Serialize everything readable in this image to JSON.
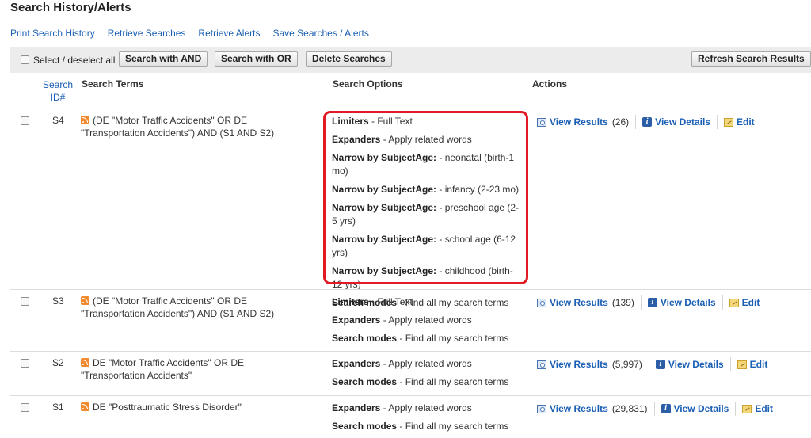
{
  "page": {
    "title": "Search History/Alerts",
    "links": [
      "Print Search History",
      "Retrieve Searches",
      "Retrieve Alerts",
      "Save Searches / Alerts"
    ]
  },
  "toolbar": {
    "select_label": "Select / deselect all",
    "and_label": "Search with AND",
    "or_label": "Search with OR",
    "delete_label": "Delete Searches",
    "refresh_label": "Refresh Search Results"
  },
  "headers": {
    "id": "Search ID#",
    "terms": "Search Terms",
    "options": "Search Options",
    "actions": "Actions"
  },
  "actions": {
    "view_results": "View Results",
    "view_details": "View Details",
    "edit": "Edit"
  },
  "rows": [
    {
      "id": "S4",
      "terms": "(DE \"Motor Traffic Accidents\" OR DE \"Transportation Accidents\") AND (S1 AND S2)",
      "count": "(26)",
      "options": [
        {
          "label": "Limiters",
          "value": " - Full Text"
        },
        {
          "label": "Expanders",
          "value": " - Apply related words"
        },
        {
          "label": "Narrow by SubjectAge:",
          "value": " - neonatal (birth-1 mo)"
        },
        {
          "label": "Narrow by SubjectAge:",
          "value": " - infancy (2-23 mo)"
        },
        {
          "label": "Narrow by SubjectAge:",
          "value": " - preschool age (2-5 yrs)"
        },
        {
          "label": "Narrow by SubjectAge:",
          "value": " - school age (6-12 yrs)"
        },
        {
          "label": "Narrow by SubjectAge:",
          "value": " - childhood (birth-12 yrs)"
        },
        {
          "label": "Search modes",
          "value": " - Find all my search terms"
        }
      ]
    },
    {
      "id": "S3",
      "terms": "(DE \"Motor Traffic Accidents\" OR DE \"Transportation Accidents\") AND (S1 AND S2)",
      "count": "(139)",
      "options": [
        {
          "label": "Limiters",
          "value": " - Full Text"
        },
        {
          "label": "Expanders",
          "value": " - Apply related words"
        },
        {
          "label": "Search modes",
          "value": " - Find all my search terms"
        }
      ]
    },
    {
      "id": "S2",
      "terms": "DE \"Motor Traffic Accidents\" OR DE \"Transportation Accidents\"",
      "count": "(5,997)",
      "options": [
        {
          "label": "Expanders",
          "value": " - Apply related words"
        },
        {
          "label": "Search modes",
          "value": " - Find all my search terms"
        }
      ]
    },
    {
      "id": "S1",
      "terms": "DE \"Posttraumatic Stress Disorder\"",
      "count": "(29,831)",
      "options": [
        {
          "label": "Expanders",
          "value": " - Apply related words"
        },
        {
          "label": "Search modes",
          "value": " - Find all my search terms"
        }
      ]
    }
  ],
  "colors": {
    "link": "#1a5fb4",
    "highlight": "#e01b24",
    "rss": "#f28b30"
  }
}
